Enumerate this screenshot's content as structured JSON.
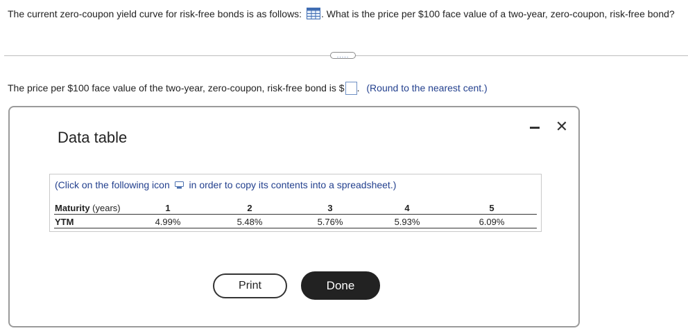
{
  "question": {
    "part1": "The current zero-coupon yield curve for risk-free bonds is as follows:",
    "table_icon": "table-grid-icon",
    "part2": ". What is the price per $100 face value of a two-year, zero-coupon, risk-free bond?"
  },
  "more_button": {
    "label": "....."
  },
  "answer": {
    "prefix": "The price per $100 face value of the two-year, zero-coupon, risk-free bond is $",
    "value": "",
    "suffix": ".",
    "note": "(Round to the nearest cent.)"
  },
  "modal": {
    "title": "Data table",
    "minimize_icon": "minimize-icon",
    "close_glyph": "✕",
    "copy_note_prefix": "(Click on the following icon",
    "copy_icon": "copy-spreadsheet-icon",
    "copy_note_suffix": "in order to copy its contents into a spreadsheet.)",
    "table": {
      "row1_label": "Maturity",
      "row1_unit": " (years)",
      "row2_label": "YTM",
      "maturities": [
        "1",
        "2",
        "3",
        "4",
        "5"
      ],
      "ytm": [
        "4.99%",
        "5.48%",
        "5.76%",
        "5.93%",
        "6.09%"
      ]
    },
    "print_label": "Print",
    "done_label": "Done"
  },
  "colors": {
    "link_blue": "#23408e",
    "done_button": "#222222",
    "input_border": "#6d8fc4"
  }
}
